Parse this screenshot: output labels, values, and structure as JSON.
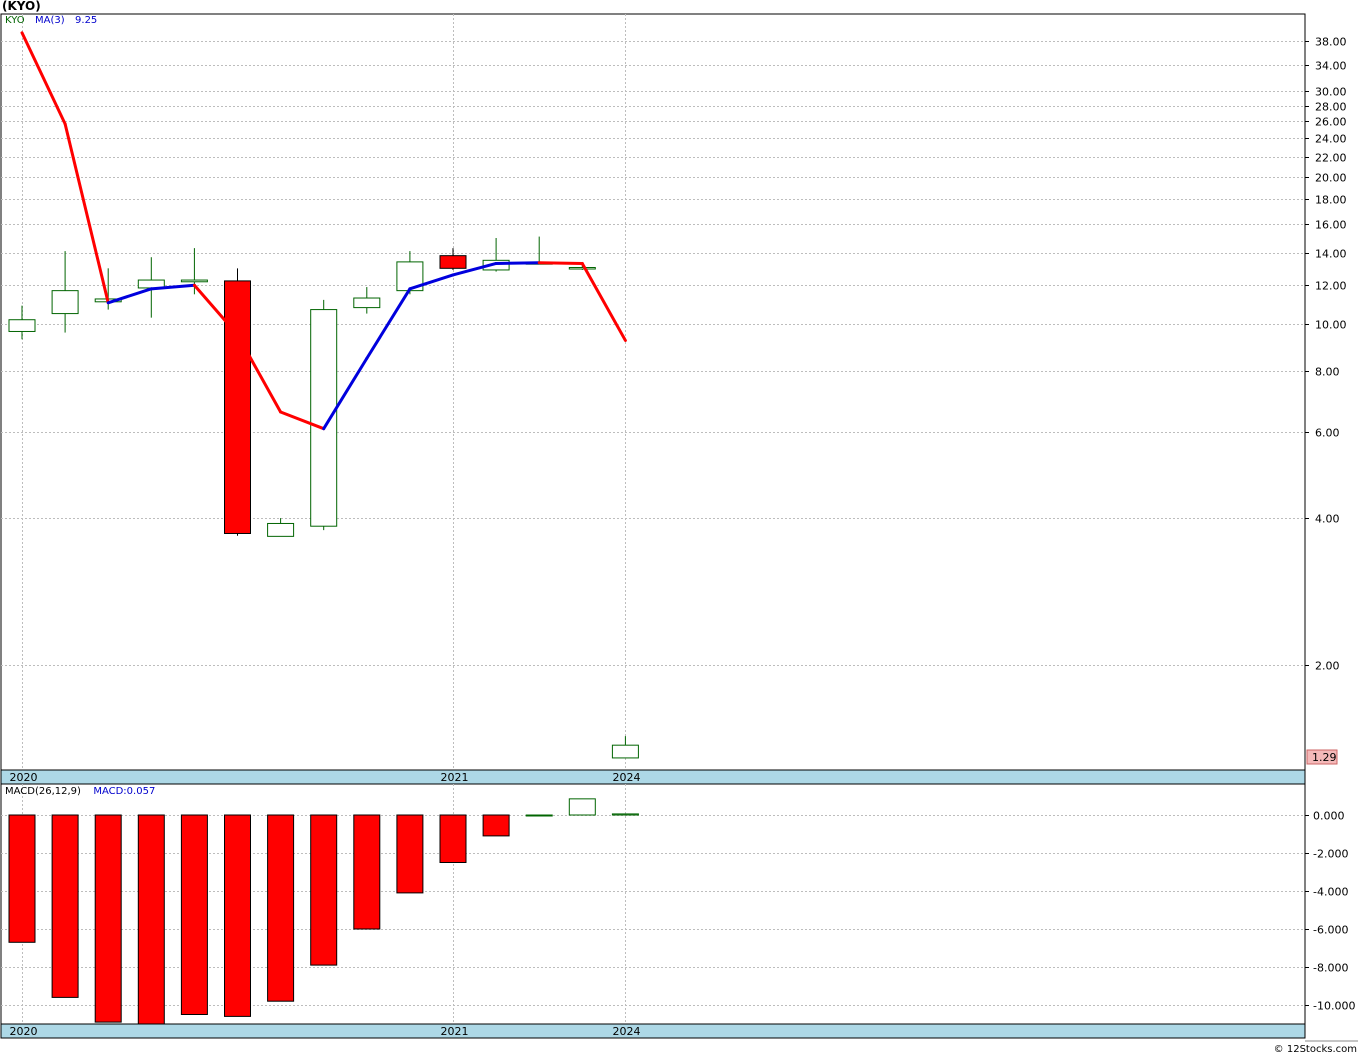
{
  "header": {
    "symbol_title": "(KYO)"
  },
  "legend": {
    "ticker": "KYO",
    "ma_label": "MA(3)",
    "ma_value": "9.25",
    "macd_label": "MACD(26,12,9)",
    "macd_value": "MACD:0.057"
  },
  "credit": "© 12Stocks.com",
  "colors": {
    "up": "#006400",
    "down": "#ff0000",
    "ma_down": "#ff0000",
    "ma_up": "#0000dd",
    "grid": "#bdbdbd",
    "date_band": "#add8e6",
    "last_price_bg": "#f4b9b9"
  },
  "chart_data": [
    {
      "type": "candlestick",
      "title": "(KYO)",
      "y_scale": "log",
      "ylim": [
        1.29,
        44
      ],
      "y_ticks": [
        "38.00",
        "34.00",
        "30.00",
        "28.00",
        "26.00",
        "24.00",
        "22.00",
        "20.00",
        "18.00",
        "16.00",
        "14.00",
        "12.00",
        "10.00",
        "8.00",
        "6.00",
        "4.00",
        "2.00"
      ],
      "x_labels": [
        {
          "label": "2020",
          "bar": 0
        },
        {
          "label": "2021",
          "bar": 10
        },
        {
          "label": "2024",
          "bar": 14
        }
      ],
      "last_price_label": "1.29",
      "grid": true,
      "candles": [
        {
          "open": 9.65,
          "high": 10.9,
          "low": 9.3,
          "close": 10.2
        },
        {
          "open": 10.5,
          "high": 14.1,
          "low": 9.6,
          "close": 11.7
        },
        {
          "open": 11.1,
          "high": 13.0,
          "low": 10.7,
          "close": 11.25
        },
        {
          "open": 11.85,
          "high": 13.7,
          "low": 10.3,
          "close": 12.3
        },
        {
          "open": 12.2,
          "high": 14.3,
          "low": 11.5,
          "close": 12.3
        },
        {
          "open": 12.25,
          "high": 13.0,
          "low": 3.68,
          "close": 3.72
        },
        {
          "open": 3.67,
          "high": 4.0,
          "low": 3.67,
          "close": 3.9
        },
        {
          "open": 3.85,
          "high": 11.2,
          "low": 3.78,
          "close": 10.7
        },
        {
          "open": 10.8,
          "high": 11.9,
          "low": 10.5,
          "close": 11.3
        },
        {
          "open": 11.7,
          "high": 14.1,
          "low": 11.5,
          "close": 13.4
        },
        {
          "open": 13.8,
          "high": 14.3,
          "low": 12.9,
          "close": 13.0
        },
        {
          "open": 12.9,
          "high": 15.0,
          "low": 12.8,
          "close": 13.5
        },
        {
          "open": 13.35,
          "high": 15.1,
          "low": 13.25,
          "close": 13.35
        },
        {
          "open": 13.05,
          "high": 13.2,
          "low": 12.9,
          "close": 13.05
        },
        {
          "open": 1.29,
          "high": 1.43,
          "low": 1.29,
          "close": 1.37
        }
      ],
      "ma3": [
        39.5,
        25.7,
        11.05,
        11.8,
        12.0,
        9.5,
        6.6,
        6.1,
        8.5,
        11.8,
        12.6,
        13.3,
        13.35,
        13.3,
        9.25
      ]
    },
    {
      "type": "bar",
      "title": "MACD(26,12,9)",
      "ylim": [
        -11.0,
        1.2
      ],
      "y_ticks": [
        "0.000",
        "-2.000",
        "-4.000",
        "-6.000",
        "-8.000",
        "-10.000"
      ],
      "x_labels": [
        {
          "label": "2020",
          "bar": 0
        },
        {
          "label": "2021",
          "bar": 10
        },
        {
          "label": "2024",
          "bar": 14
        }
      ],
      "grid": true,
      "series": [
        {
          "name": "MACD",
          "values": [
            -6.7,
            -9.6,
            -10.9,
            -11.0,
            -10.5,
            -10.6,
            -9.8,
            -7.9,
            -6.0,
            -4.1,
            -2.5,
            -1.1,
            0.0,
            0.85,
            0.057
          ]
        }
      ]
    }
  ]
}
